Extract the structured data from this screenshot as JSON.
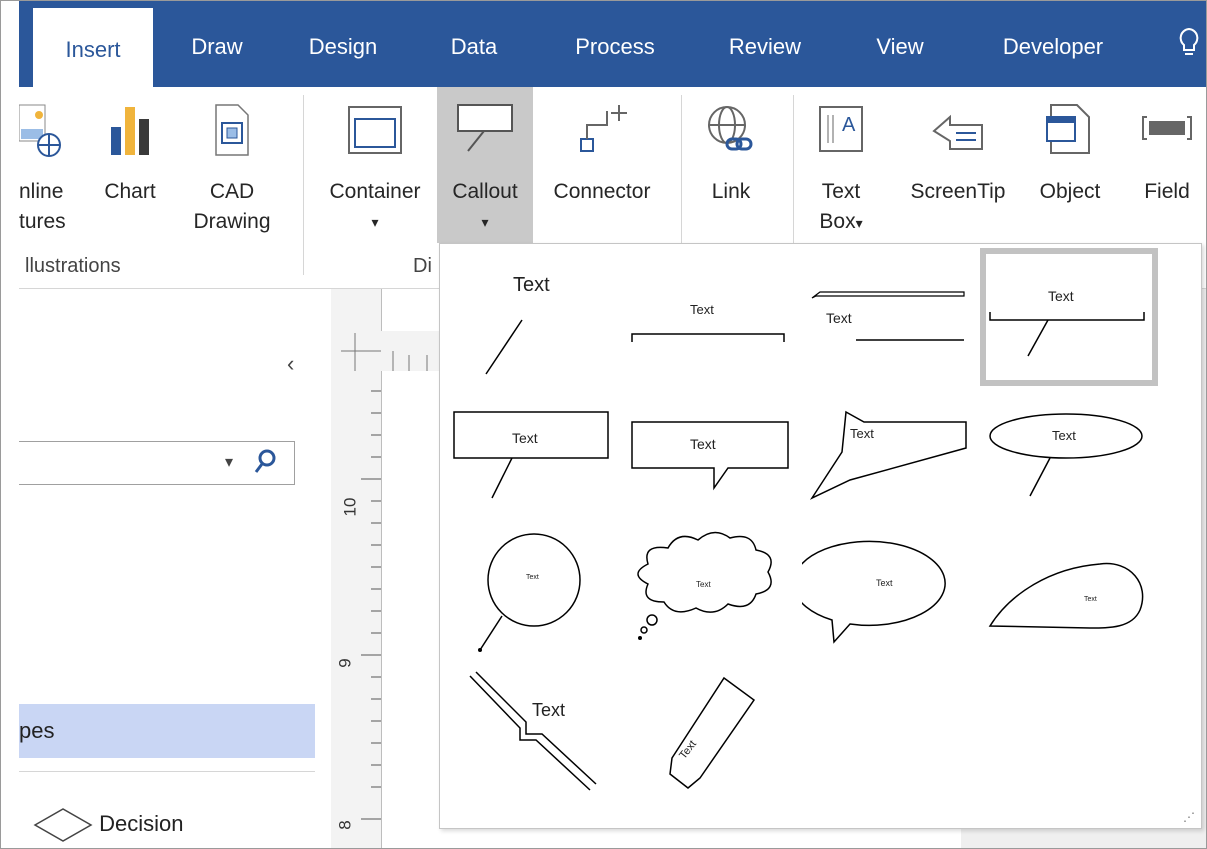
{
  "tabs": [
    {
      "label": "Insert",
      "active": true
    },
    {
      "label": "Draw"
    },
    {
      "label": "Design"
    },
    {
      "label": "Data"
    },
    {
      "label": "Process"
    },
    {
      "label": "Review"
    },
    {
      "label": "View"
    },
    {
      "label": "Developer"
    }
  ],
  "ribbon": {
    "online_pictures": [
      "nline",
      "tures"
    ],
    "chart": "Chart",
    "cad": [
      "CAD",
      "Drawing"
    ],
    "container": "Container",
    "callout": "Callout",
    "connector": "Connector",
    "link": "Link",
    "textbox": [
      "Text",
      "Box"
    ],
    "screentip": "ScreenTip",
    "object": "Object",
    "field": "Field",
    "group_illustrations": "llustrations",
    "group_diagram_parts": "Di"
  },
  "pane": {
    "stencil": "pes",
    "decision": "Decision"
  },
  "ruler": {
    "labels": [
      "10",
      "9",
      "8"
    ]
  },
  "gallery": {
    "callouts": [
      {
        "text": "Text"
      },
      {
        "text": "Text"
      },
      {
        "text": "Text"
      },
      {
        "text": "Text"
      },
      {
        "text": "Text"
      },
      {
        "text": "Text"
      },
      {
        "text": "Text"
      },
      {
        "text": "Text"
      },
      {
        "text": "Text"
      },
      {
        "text": "Text"
      },
      {
        "text": "Text"
      },
      {
        "text": "Text"
      },
      {
        "text": "Text"
      },
      {
        "text": "Text"
      }
    ]
  },
  "colors": {
    "accent": "#2b579a",
    "selected_stencil": "#c9d6f4"
  }
}
